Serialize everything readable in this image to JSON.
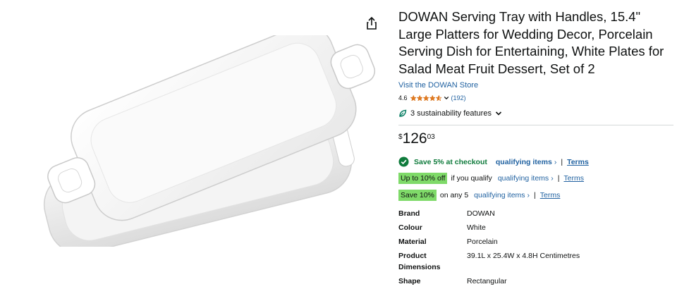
{
  "product": {
    "title": "DOWAN Serving Tray with Handles, 15.4\" Large Platters for Wedding Decor, Porcelain Serving Dish for Entertaining, White Plates for Salad Meat Fruit Dessert, Set of 2",
    "store_link": "Visit the DOWAN Store",
    "rating": "4.6",
    "rating_stars": 4.6,
    "review_count": "(192)",
    "sustainability": "3 sustainability features"
  },
  "price": {
    "symbol": "$",
    "whole": "126",
    "fraction": "03"
  },
  "promos": {
    "checkout": {
      "text": "Save 5% at checkout",
      "link": "qualifying items",
      "chevron": "›",
      "separator": "|",
      "terms": "Terms"
    },
    "qualify": {
      "badge": "Up to 10% off",
      "text": "if you qualify",
      "link": "qualifying items",
      "chevron": "›",
      "separator": "|",
      "terms": "Terms"
    },
    "bundle": {
      "badge": "Save 10%",
      "text": "on any 5",
      "link": "qualifying items",
      "chevron": "›",
      "separator": "|",
      "terms": "Terms"
    }
  },
  "specs": [
    {
      "key": "Brand",
      "value": "DOWAN"
    },
    {
      "key": "Colour",
      "value": "White"
    },
    {
      "key": "Material",
      "value": "Porcelain"
    },
    {
      "key": "Product Dimensions",
      "value": "39.1L x 25.4W x 4.8H Centimetres"
    },
    {
      "key": "Shape",
      "value": "Rectangular"
    }
  ],
  "colors": {
    "link": "#2162a1",
    "star": "#de7921",
    "badge": "#7fda69",
    "promo_green": "#0f7b3c"
  },
  "icons": [
    "share-icon",
    "star-icon",
    "chevron-down-icon",
    "leaf-icon",
    "check-circle-icon"
  ]
}
